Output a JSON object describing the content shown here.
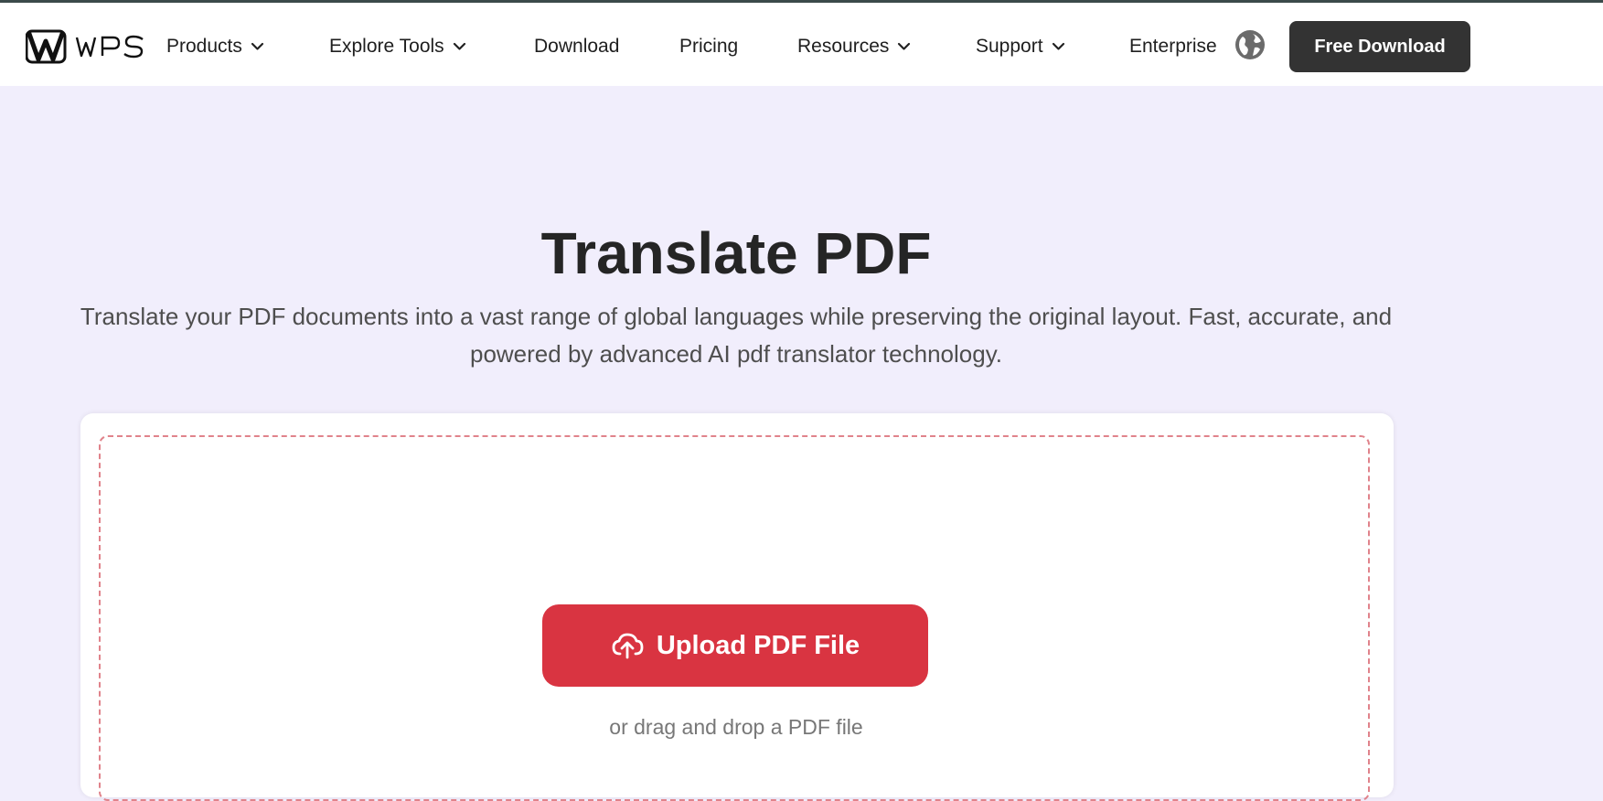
{
  "brand": {
    "name": "WPS",
    "icon": "wps-logo-icon"
  },
  "nav": {
    "items": [
      {
        "label": "Products",
        "has_dropdown": true
      },
      {
        "label": "Explore Tools",
        "has_dropdown": true
      },
      {
        "label": "Download",
        "has_dropdown": false
      },
      {
        "label": "Pricing",
        "has_dropdown": false
      },
      {
        "label": "Resources",
        "has_dropdown": true
      },
      {
        "label": "Support",
        "has_dropdown": true
      },
      {
        "label": "Enterprise",
        "has_dropdown": false
      }
    ],
    "language_icon": "globe-icon",
    "cta_label": "Free Download"
  },
  "hero": {
    "title": "Translate PDF",
    "subtitle": "Translate your PDF documents into a vast range of global languages while preserving the original layout. Fast, accurate, and powered by advanced AI pdf translator technology."
  },
  "upload": {
    "button_label": "Upload PDF File",
    "button_icon": "cloud-upload-icon",
    "drag_hint": "or drag and drop a PDF file"
  },
  "colors": {
    "page_background": "#f1eefc",
    "cta_background": "#333333",
    "upload_button": "#d93441",
    "dropzone_border": "#e0838b"
  }
}
